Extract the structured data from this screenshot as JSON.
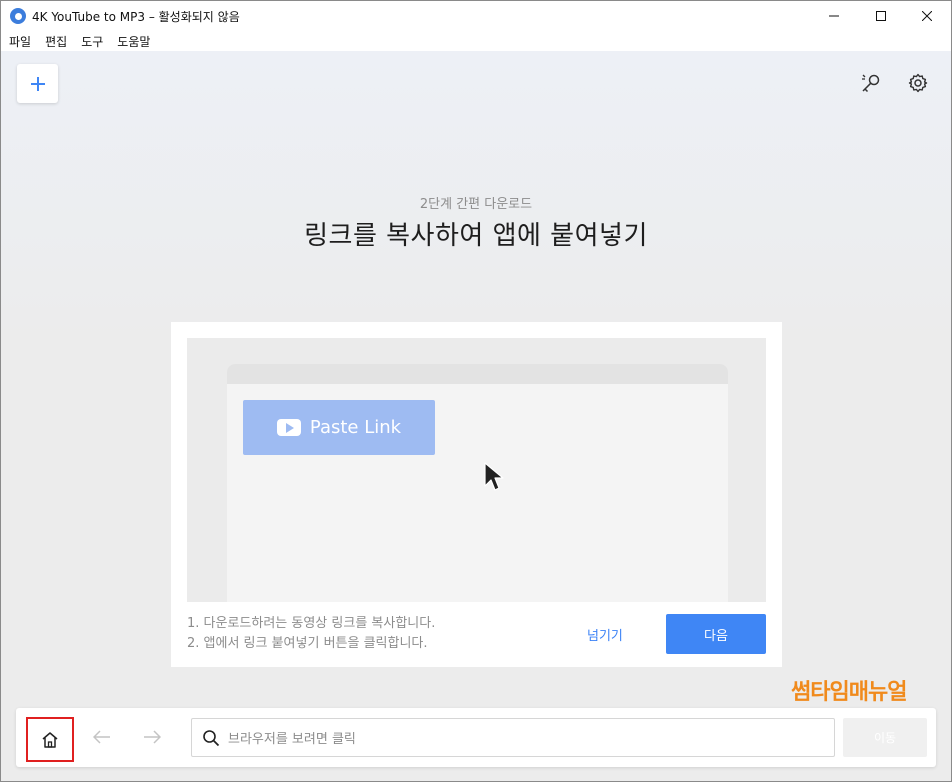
{
  "window": {
    "title": "4K YouTube to MP3 – 활성화되지 않음"
  },
  "menu": [
    "파일",
    "편집",
    "도구",
    "도움말"
  ],
  "toolbar": {
    "add_icon": "plus-icon",
    "key_icon": "key-icon",
    "settings_icon": "gear-icon"
  },
  "intro": {
    "subtitle": "2단계 간편 다운로드",
    "headline": "링크를 복사하여 앱에 붙여넣기"
  },
  "demo": {
    "paste_button_label": "Paste Link"
  },
  "steps": [
    "1. 다운로드하려는 동영상 링크를 복사합니다.",
    "2. 앱에서 링크 붙여넣기 버튼을 클릭합니다."
  ],
  "actions": {
    "skip_label": "넘기기",
    "next_label": "다음"
  },
  "watermark": "썸타임매뉴얼",
  "browser": {
    "search_placeholder": "브라우저를 보려면 클릭",
    "go_label": "이동"
  },
  "colors": {
    "accent": "#3f86f5",
    "paste_button": "#9ebbf2",
    "watermark": "#f08a1c",
    "highlight_box": "#e02020"
  }
}
